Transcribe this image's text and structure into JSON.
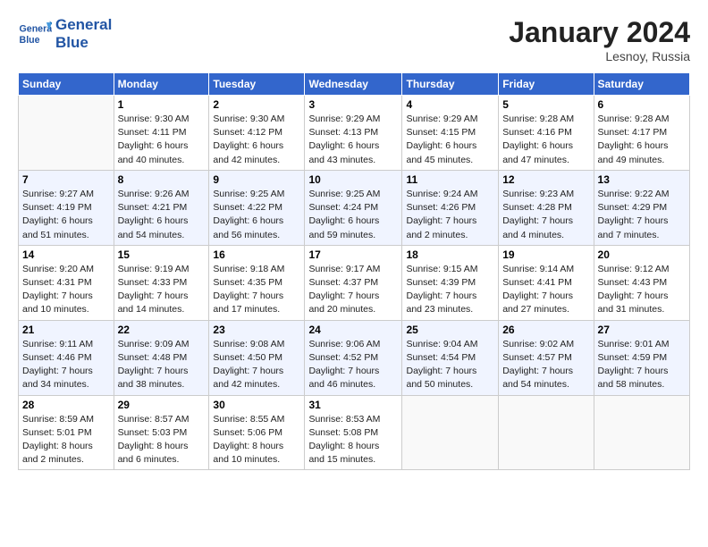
{
  "logo": {
    "line1": "General",
    "line2": "Blue"
  },
  "title": "January 2024",
  "location": "Lesnoy, Russia",
  "days_header": [
    "Sunday",
    "Monday",
    "Tuesday",
    "Wednesday",
    "Thursday",
    "Friday",
    "Saturday"
  ],
  "weeks": [
    [
      {
        "num": "",
        "info": ""
      },
      {
        "num": "1",
        "info": "Sunrise: 9:30 AM\nSunset: 4:11 PM\nDaylight: 6 hours\nand 40 minutes."
      },
      {
        "num": "2",
        "info": "Sunrise: 9:30 AM\nSunset: 4:12 PM\nDaylight: 6 hours\nand 42 minutes."
      },
      {
        "num": "3",
        "info": "Sunrise: 9:29 AM\nSunset: 4:13 PM\nDaylight: 6 hours\nand 43 minutes."
      },
      {
        "num": "4",
        "info": "Sunrise: 9:29 AM\nSunset: 4:15 PM\nDaylight: 6 hours\nand 45 minutes."
      },
      {
        "num": "5",
        "info": "Sunrise: 9:28 AM\nSunset: 4:16 PM\nDaylight: 6 hours\nand 47 minutes."
      },
      {
        "num": "6",
        "info": "Sunrise: 9:28 AM\nSunset: 4:17 PM\nDaylight: 6 hours\nand 49 minutes."
      }
    ],
    [
      {
        "num": "7",
        "info": "Sunrise: 9:27 AM\nSunset: 4:19 PM\nDaylight: 6 hours\nand 51 minutes."
      },
      {
        "num": "8",
        "info": "Sunrise: 9:26 AM\nSunset: 4:21 PM\nDaylight: 6 hours\nand 54 minutes."
      },
      {
        "num": "9",
        "info": "Sunrise: 9:25 AM\nSunset: 4:22 PM\nDaylight: 6 hours\nand 56 minutes."
      },
      {
        "num": "10",
        "info": "Sunrise: 9:25 AM\nSunset: 4:24 PM\nDaylight: 6 hours\nand 59 minutes."
      },
      {
        "num": "11",
        "info": "Sunrise: 9:24 AM\nSunset: 4:26 PM\nDaylight: 7 hours\nand 2 minutes."
      },
      {
        "num": "12",
        "info": "Sunrise: 9:23 AM\nSunset: 4:28 PM\nDaylight: 7 hours\nand 4 minutes."
      },
      {
        "num": "13",
        "info": "Sunrise: 9:22 AM\nSunset: 4:29 PM\nDaylight: 7 hours\nand 7 minutes."
      }
    ],
    [
      {
        "num": "14",
        "info": "Sunrise: 9:20 AM\nSunset: 4:31 PM\nDaylight: 7 hours\nand 10 minutes."
      },
      {
        "num": "15",
        "info": "Sunrise: 9:19 AM\nSunset: 4:33 PM\nDaylight: 7 hours\nand 14 minutes."
      },
      {
        "num": "16",
        "info": "Sunrise: 9:18 AM\nSunset: 4:35 PM\nDaylight: 7 hours\nand 17 minutes."
      },
      {
        "num": "17",
        "info": "Sunrise: 9:17 AM\nSunset: 4:37 PM\nDaylight: 7 hours\nand 20 minutes."
      },
      {
        "num": "18",
        "info": "Sunrise: 9:15 AM\nSunset: 4:39 PM\nDaylight: 7 hours\nand 23 minutes."
      },
      {
        "num": "19",
        "info": "Sunrise: 9:14 AM\nSunset: 4:41 PM\nDaylight: 7 hours\nand 27 minutes."
      },
      {
        "num": "20",
        "info": "Sunrise: 9:12 AM\nSunset: 4:43 PM\nDaylight: 7 hours\nand 31 minutes."
      }
    ],
    [
      {
        "num": "21",
        "info": "Sunrise: 9:11 AM\nSunset: 4:46 PM\nDaylight: 7 hours\nand 34 minutes."
      },
      {
        "num": "22",
        "info": "Sunrise: 9:09 AM\nSunset: 4:48 PM\nDaylight: 7 hours\nand 38 minutes."
      },
      {
        "num": "23",
        "info": "Sunrise: 9:08 AM\nSunset: 4:50 PM\nDaylight: 7 hours\nand 42 minutes."
      },
      {
        "num": "24",
        "info": "Sunrise: 9:06 AM\nSunset: 4:52 PM\nDaylight: 7 hours\nand 46 minutes."
      },
      {
        "num": "25",
        "info": "Sunrise: 9:04 AM\nSunset: 4:54 PM\nDaylight: 7 hours\nand 50 minutes."
      },
      {
        "num": "26",
        "info": "Sunrise: 9:02 AM\nSunset: 4:57 PM\nDaylight: 7 hours\nand 54 minutes."
      },
      {
        "num": "27",
        "info": "Sunrise: 9:01 AM\nSunset: 4:59 PM\nDaylight: 7 hours\nand 58 minutes."
      }
    ],
    [
      {
        "num": "28",
        "info": "Sunrise: 8:59 AM\nSunset: 5:01 PM\nDaylight: 8 hours\nand 2 minutes."
      },
      {
        "num": "29",
        "info": "Sunrise: 8:57 AM\nSunset: 5:03 PM\nDaylight: 8 hours\nand 6 minutes."
      },
      {
        "num": "30",
        "info": "Sunrise: 8:55 AM\nSunset: 5:06 PM\nDaylight: 8 hours\nand 10 minutes."
      },
      {
        "num": "31",
        "info": "Sunrise: 8:53 AM\nSunset: 5:08 PM\nDaylight: 8 hours\nand 15 minutes."
      },
      {
        "num": "",
        "info": ""
      },
      {
        "num": "",
        "info": ""
      },
      {
        "num": "",
        "info": ""
      }
    ]
  ]
}
